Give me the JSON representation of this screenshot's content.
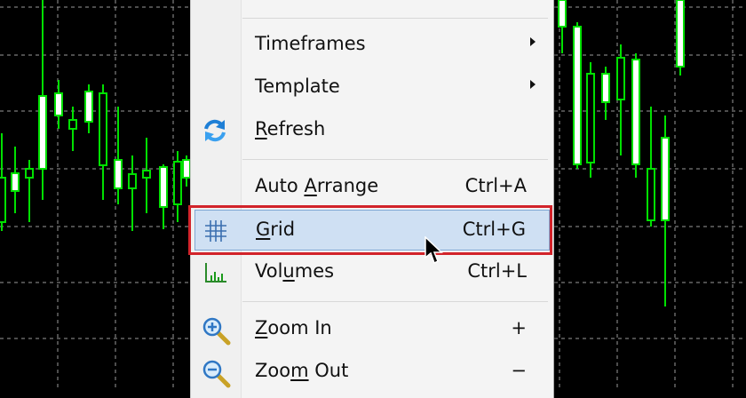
{
  "chart": {
    "background": "#000000",
    "grid_color": "#9a9a9a",
    "candle_color": "#00e000"
  },
  "menu": {
    "items": [
      {
        "label": "Timeframes",
        "has_submenu": true
      },
      {
        "label": "Template",
        "has_submenu": true
      },
      {
        "label_pre": "",
        "label_u": "R",
        "label_post": "efresh",
        "icon": "refresh-icon"
      },
      {
        "label_pre": "Auto ",
        "label_u": "A",
        "label_post": "rrange",
        "shortcut": "Ctrl+A"
      },
      {
        "label_pre": "",
        "label_u": "G",
        "label_post": "rid",
        "shortcut": "Ctrl+G",
        "icon": "grid-icon",
        "highlighted": true
      },
      {
        "label_pre": "Vol",
        "label_u": "u",
        "label_post": "mes",
        "shortcut": "Ctrl+L",
        "icon": "volumes-icon"
      },
      {
        "label_pre": "",
        "label_u": "Z",
        "label_post": "oom In",
        "shortcut": "+",
        "icon": "zoom-in-icon"
      },
      {
        "label_pre": "Zoo",
        "label_u": "m",
        "label_post": " Out",
        "shortcut": "−",
        "icon": "zoom-out-icon"
      }
    ],
    "highlight_color": "#cfe0f3",
    "annotation_box_color": "#d2232a"
  }
}
